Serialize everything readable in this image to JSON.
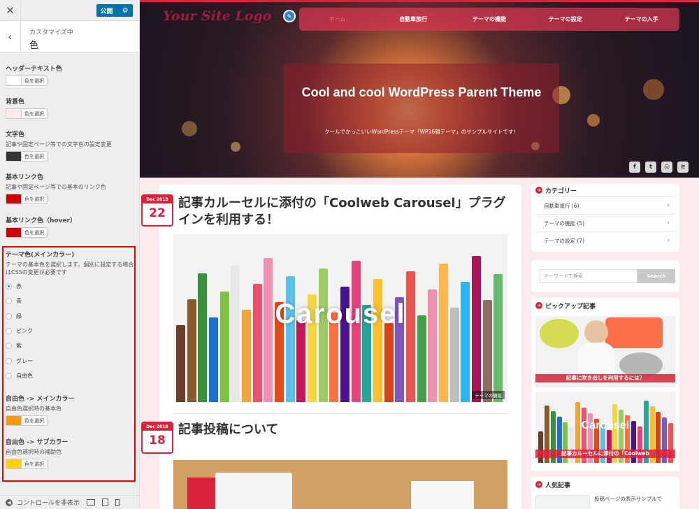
{
  "customizer": {
    "close_icon": "close-icon",
    "publish_label": "公開",
    "section_sub": "カスタマイズ中",
    "section_title": "色",
    "controls": [
      {
        "title": "ヘッダーテキスト色",
        "desc": "",
        "color": "#ffffff",
        "button": "色を選択"
      },
      {
        "title": "背景色",
        "desc": "",
        "color": "#fdeaea",
        "button": "色を選択"
      },
      {
        "title": "文字色",
        "desc": "記事や固定ページ等での文字色の設定変更",
        "color": "#333333",
        "button": "色を選択"
      },
      {
        "title": "基本リンク色",
        "desc": "記事や固定ページ等での基本のリンク色",
        "color": "#cc0000",
        "button": "色を選択"
      },
      {
        "title": "基本リンク色（hover）",
        "desc": "",
        "color": "#cc0000",
        "button": "色を選択"
      }
    ],
    "theme_color": {
      "title": "テーマ色(メインカラー)",
      "desc": "テーマの基本色を選択します。個別に設定する場合はCSSの変更が必要です",
      "options": [
        "赤",
        "青",
        "緑",
        "ピンク",
        "紫",
        "グレー",
        "自由色"
      ],
      "selected": "赤"
    },
    "free_main": {
      "title": "自由色 -> メインカラー",
      "desc": "自由色選択時の基本色",
      "color": "#ff9900",
      "button": "色を選択"
    },
    "free_sub": {
      "title": "自由色 -> サブカラー",
      "desc": "自由色選択時の補助色",
      "color": "#ffd200",
      "button": "色を選択"
    },
    "footer_label": "コントロールを非表示"
  },
  "site": {
    "logo": "Your Site Logo",
    "nav": [
      "ホーム",
      "自動車旅行",
      "テーマの機能",
      "テーマの設定",
      "テーマの入手"
    ],
    "hero_title": "Cool and cool WordPress Parent Theme",
    "hero_subtitle": "クールでかっこいいWordPressテーマ「WP16親テーマ」のサンプルサイトです！",
    "social": [
      "f",
      "t",
      "◎",
      "≋"
    ],
    "posts": [
      {
        "month": "Dec 2018",
        "day": "22",
        "title": "記事カルーセルに添付の「Coolweb Carousel」プラグインを利用する！",
        "image_text": "Carousel",
        "category": "テーマの機能"
      },
      {
        "month": "Dec 2018",
        "day": "18",
        "title": "記事投稿について"
      }
    ],
    "sidebar": {
      "categories_title": "カテゴリー",
      "categories": [
        {
          "label": "自動車旅行 (6)"
        },
        {
          "label": "テーマの機能 (5)"
        },
        {
          "label": "テーマの設定 (7)"
        }
      ],
      "search_placeholder": "キーワードで検索",
      "search_button": "Search",
      "pickup_title": "ピックアップ記事",
      "pickups": [
        "記事に吹き出しを利用するには？",
        "記事カルーセルに添付の「Coolweb"
      ],
      "popular_title": "人気記事",
      "popular_first": "投稿ページの表示サンプルで",
      "pickup2_overlay": "Carousel"
    }
  },
  "colors": {
    "accent": "#d8233a",
    "wp_blue": "#0073aa",
    "highlight_border": "#ee0000"
  }
}
